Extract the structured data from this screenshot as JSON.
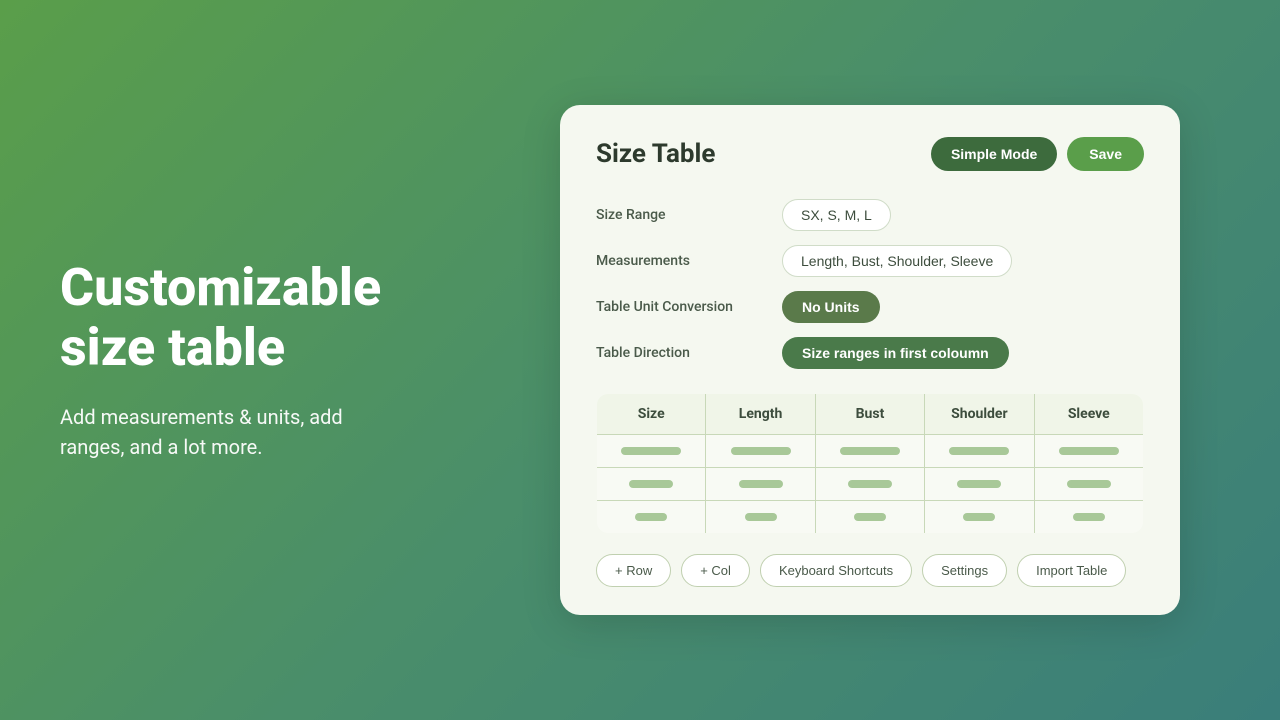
{
  "left": {
    "headline_line1": "Customizable",
    "headline_line2": "size table",
    "description": "Add measurements & units, add ranges, and a lot more."
  },
  "card": {
    "title": "Size Table",
    "simple_mode_label": "Simple Mode",
    "save_label": "Save",
    "form": {
      "size_range_label": "Size Range",
      "size_range_value": "SX, S, M, L",
      "measurements_label": "Measurements",
      "measurements_value": "Length, Bust, Shoulder, Sleeve",
      "table_unit_label": "Table Unit Conversion",
      "table_unit_value": "No Units",
      "table_direction_label": "Table Direction",
      "table_direction_value": "Size ranges in first coloumn"
    },
    "table": {
      "columns": [
        "Size",
        "Length",
        "Bust",
        "Shoulder",
        "Sleeve"
      ]
    },
    "toolbar": {
      "add_row": "+ Row",
      "add_col": "+ Col",
      "keyboard_shortcuts": "Keyboard Shortcuts",
      "settings": "Settings",
      "import_table": "Import Table"
    }
  }
}
